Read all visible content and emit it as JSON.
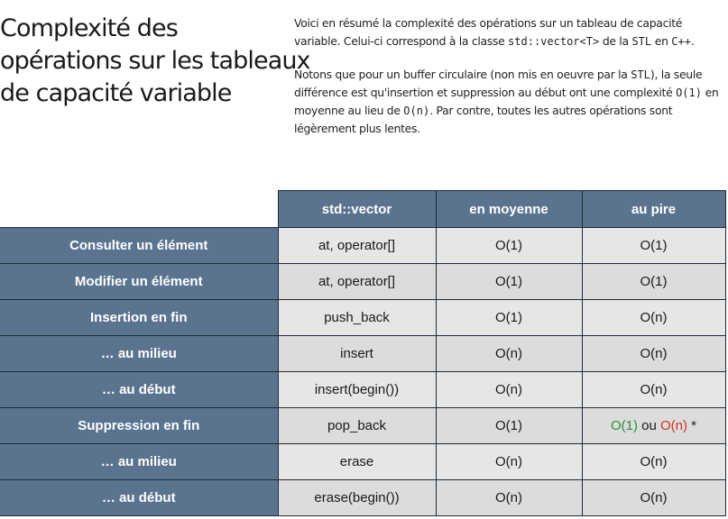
{
  "title": {
    "line1": "Complexité des",
    "line2": "opérations sur les tableaux",
    "line3": "de capacité variable"
  },
  "intro": {
    "p1_a": "Voici en résumé la complexité des opérations sur un tableau de capacité variable. Celui-ci correspond à la classe ",
    "p1_code1": "std::vector<T>",
    "p1_b": " de la ",
    "p1_code2": "STL",
    "p1_c": " en ",
    "p1_code3": "C++",
    "p1_d": ".",
    "p2_a": "Notons que pour un buffer circulaire (non mis en oeuvre par la ",
    "p2_code1": "STL",
    "p2_b": "), la seule différence est qu'insertion et suppression au début ont une complexité ",
    "p2_code2": "O(1)",
    "p2_c": " en moyenne au lieu de ",
    "p2_code3": "O(n)",
    "p2_d": ".  Par contre, toutes les autres opérations sont légèrement plus lentes."
  },
  "table": {
    "headers": [
      "std::vector",
      "en moyenne",
      "au pire"
    ],
    "rows": [
      {
        "label": "Consulter un élément",
        "method": "at, operator[]",
        "avg": "O(1)",
        "worst": "O(1)"
      },
      {
        "label": "Modifier un élément",
        "method": "at, operator[]",
        "avg": "O(1)",
        "worst": "O(1)"
      },
      {
        "label": "Insertion en fin",
        "method": "push_back",
        "avg": "O(1)",
        "worst": "O(n)"
      },
      {
        "label": "… au milieu",
        "method": "insert",
        "avg": "O(n)",
        "worst": "O(n)"
      },
      {
        "label": "… au début",
        "method": "insert(begin())",
        "avg": "O(n)",
        "worst": "O(n)"
      },
      {
        "label": "Suppression en fin",
        "method": "pop_back",
        "avg": "O(1)",
        "worst_a": "O(1)",
        "worst_sep": " ou ",
        "worst_b": "O(n)",
        "worst_note": " *"
      },
      {
        "label": "… au milieu",
        "method": "erase",
        "avg": "O(n)",
        "worst": "O(n)"
      },
      {
        "label": "… au début",
        "method": "erase(begin())",
        "avg": "O(n)",
        "worst": "O(n)"
      }
    ]
  },
  "colors": {
    "header_bg": "#5a7490",
    "good": "#23923a",
    "bad": "#d2311f",
    "cell_bg": "#e6e6e6"
  }
}
